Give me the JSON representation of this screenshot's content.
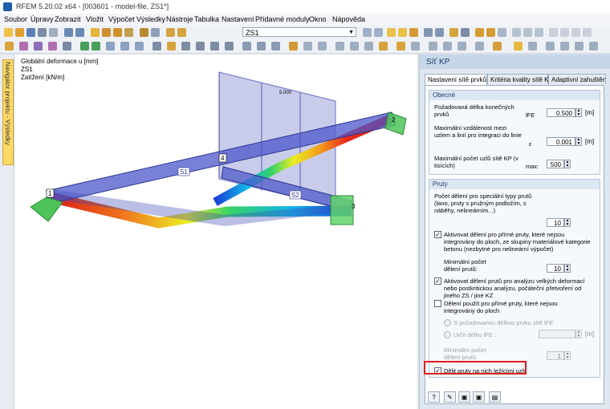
{
  "window": {
    "title": "RFEM 5.20.02 x64 - [003601 - model-file, ZS1*]"
  },
  "menu": [
    "Soubor",
    "Úpravy",
    "Zobrazit",
    "Vložit",
    "Výpočet",
    "Výsledky",
    "Nástroje",
    "Tabulka",
    "Nastavení",
    "Přídavné moduly",
    "Okno",
    "Nápověda"
  ],
  "toolbar": {
    "load_case": "ZS1"
  },
  "navigator": {
    "label": "Navigátor projektu - Výsledky"
  },
  "viewport": {
    "info": [
      "Globální deformace u [mm]",
      "ZS1",
      "Zatížení [kN/m]"
    ],
    "load_value": "5.000",
    "nodes": [
      "1",
      "2",
      "3",
      "4"
    ],
    "members": [
      "S1",
      "S2"
    ]
  },
  "panel": {
    "title": "Síť KP",
    "tabs": [
      "Nastavení sítě prvků",
      "Kritéria kvality sítě KP",
      "Adaptivní zahuštění sítě"
    ],
    "general": {
      "title": "Obecné",
      "fe_length_label": "Požadovaná délka konečných prvků",
      "fe_symbol": "lFE",
      "fe_value": "0.500",
      "fe_unit": "[m]",
      "eps_label": "Maximální vzdálenost mezi uzlem a linií pro integraci do linie",
      "eps_symbol": "ε",
      "eps_value": "0.001",
      "eps_unit": "[m]",
      "max_nodes_label": "Maximální počet uzlů sítě KP (v tisících)",
      "max_symbol": "max:",
      "max_value": "500"
    },
    "members": {
      "title": "Pruty",
      "divisions_label": "Počet dělení pro speciální typy prutů (lano, pruty s pružným podložím, s náběhy, nelineárním...)",
      "divisions_value": "10",
      "chk1": {
        "checked": true,
        "label": "Aktivovat dělení pro přímé pruty, které nejsou integrovány do ploch, ze skupiny materiálové kategorie betonu (nezbytné pro nelineární výpočet)"
      },
      "min_div_label1": "Minimální počet dělení prutů:",
      "min_div_value1": "10",
      "chk2": {
        "checked": true,
        "label": "Aktivovat dělení prutů pro analýzu velkých deformací nebo postkritickou analýzu, počáteční přetvoření od jiného ZS / jiné KZ"
      },
      "chk3": {
        "checked": false,
        "label": "Dělení použít pro přímé pruty, které nejsou integrovány do ploch"
      },
      "radio1": "S požadovanou délkou prvku sítě lFE",
      "radio2": "Určit délku lFE :",
      "radio2_unit": "[m]",
      "min_div_label2": "Minimální počet dělení prutů:",
      "min_div_value2": "1",
      "chk4": {
        "checked": true,
        "label": "Dělit pruty na nich ležícími uzly"
      }
    }
  },
  "colors": {
    "accent_red": "#e01b1b",
    "member_blue": "#4b57c9"
  }
}
